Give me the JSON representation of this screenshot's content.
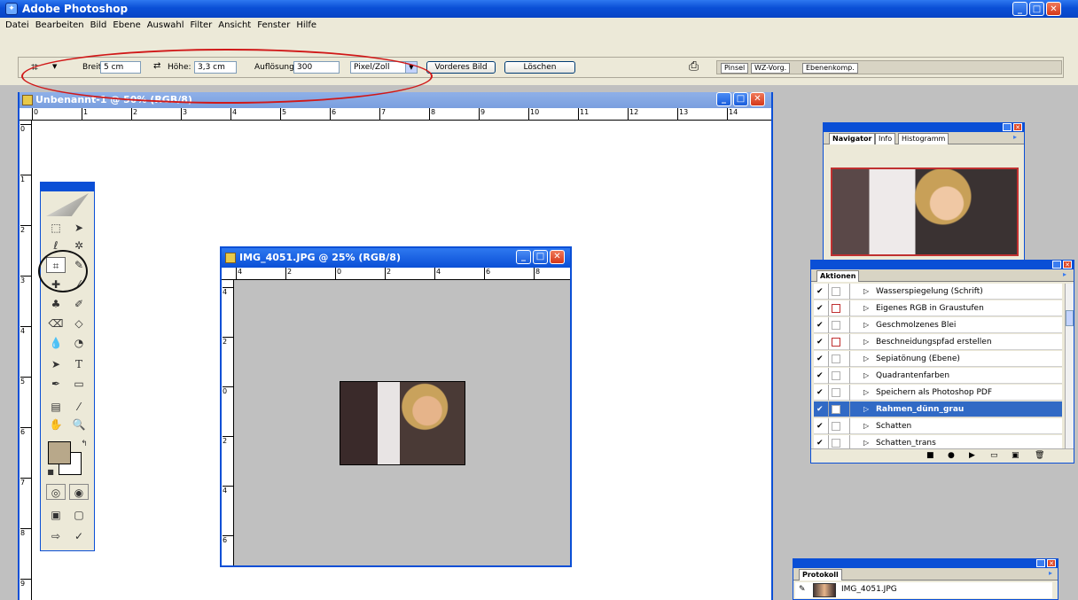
{
  "app": {
    "title": "Adobe Photoshop"
  },
  "menu": [
    "Datei",
    "Bearbeiten",
    "Bild",
    "Ebene",
    "Auswahl",
    "Filter",
    "Ansicht",
    "Fenster",
    "Hilfe"
  ],
  "options": {
    "breite_label": "Breite:",
    "breite_value": "5 cm",
    "hoehe_label": "Höhe:",
    "hoehe_value": "3,3 cm",
    "aufloesung_label": "Auflösung:",
    "aufloesung_value": "300",
    "unit_value": "Pixel/Zoll",
    "front_image_label": "Vorderes Bild",
    "clear_label": "Löschen",
    "palette_tabs": [
      "Pinsel",
      "WZ-Vorg.",
      "Ebenenkomp."
    ]
  },
  "document": {
    "title": "Unbenannt-1 @ 50% (RGB/8)",
    "ruler_ticks": [
      "0",
      "1",
      "2",
      "3",
      "4",
      "5",
      "6",
      "7",
      "8",
      "9",
      "10",
      "11",
      "12",
      "13",
      "14"
    ],
    "vruler_ticks": [
      "0",
      "1",
      "2",
      "3",
      "4",
      "5",
      "6",
      "7",
      "8",
      "9"
    ]
  },
  "image_window": {
    "title": "IMG_4051.JPG @ 25% (RGB/8)",
    "ruler_ticks": [
      "4",
      "2",
      "0",
      "2",
      "4",
      "6",
      "8"
    ],
    "vruler_ticks": [
      "4",
      "2",
      "0",
      "2",
      "4",
      "6"
    ]
  },
  "navigator": {
    "tabs": [
      "Navigator",
      "Info",
      "Histogramm"
    ]
  },
  "actions": {
    "tab": "Aktionen",
    "items": [
      {
        "name": "Wasserspiegelung (Schrift)",
        "checked": true,
        "dialog": "none"
      },
      {
        "name": "Eigenes RGB in Graustufen",
        "checked": true,
        "dialog": "red"
      },
      {
        "name": "Geschmolzenes Blei",
        "checked": true,
        "dialog": "none"
      },
      {
        "name": "Beschneidungspfad erstellen",
        "checked": true,
        "dialog": "red"
      },
      {
        "name": "Sepiatönung (Ebene)",
        "checked": true,
        "dialog": "none"
      },
      {
        "name": "Quadrantenfarben",
        "checked": true,
        "dialog": "none"
      },
      {
        "name": "Speichern als Photoshop PDF",
        "checked": true,
        "dialog": "gray"
      },
      {
        "name": "Rahmen_dünn_grau",
        "checked": true,
        "dialog": "none",
        "selected": true
      },
      {
        "name": "Schatten",
        "checked": true,
        "dialog": "none"
      },
      {
        "name": "Schatten_trans",
        "checked": true,
        "dialog": "none"
      }
    ]
  },
  "history": {
    "tab": "Protokoll",
    "item": "IMG_4051.JPG"
  },
  "colors": {
    "accent": "#0a4fd6",
    "selection": "#316ac5",
    "foreground_swatch": "#b8a88a"
  }
}
